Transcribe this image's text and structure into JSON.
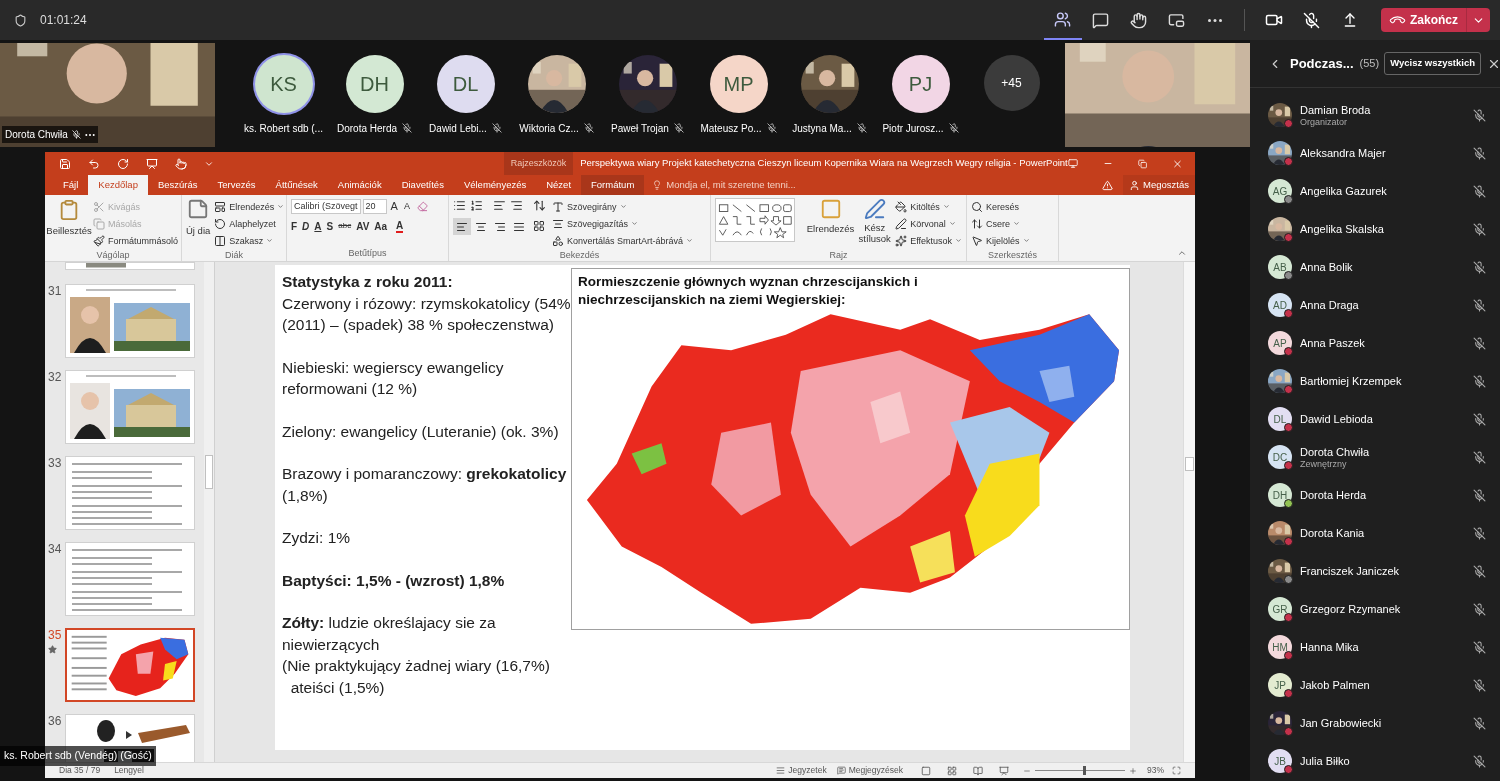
{
  "call_bar": {
    "timer": "01:01:24",
    "toolbar": [
      {
        "selected": true
      },
      {
        "selected": false
      },
      {
        "selected": false
      },
      {
        "selected": false
      },
      {
        "selected": false
      }
    ],
    "camera_on": true,
    "mic_muted": true,
    "end_button": "Zakończ"
  },
  "strip": {
    "left_video": {
      "name": "Dorota Chwiła",
      "muted": true
    },
    "avatars": [
      {
        "initials": "KS",
        "name": "ks. Robert sdb (...",
        "kind": "initials",
        "color": "#cfe5cf",
        "speaking": true,
        "muted": false
      },
      {
        "initials": "DH",
        "name": "Dorota Herda",
        "kind": "initials",
        "color": "#d3e8d3",
        "speaking": false,
        "muted": true
      },
      {
        "initials": "DL",
        "name": "Dawid Lebi...",
        "kind": "initials",
        "color": "#dedcf0",
        "speaking": false,
        "muted": true
      },
      {
        "name": "Wiktoria Cz...",
        "kind": "picture",
        "speaking": false,
        "muted": true
      },
      {
        "name": "Paweł Trojan",
        "kind": "picture",
        "speaking": false,
        "muted": true
      },
      {
        "initials": "MP",
        "name": "Mateusz Po...",
        "kind": "initials",
        "color": "#f5d6c8",
        "speaking": false,
        "muted": true
      },
      {
        "name": "Justyna Ma...",
        "kind": "picture",
        "speaking": false,
        "muted": true
      },
      {
        "initials": "PJ",
        "name": "Piotr Jurosz...",
        "kind": "initials",
        "color": "#f2d6e5",
        "speaking": false,
        "muted": true
      }
    ],
    "overflow": "+45"
  },
  "powerpoint": {
    "context_group": "Rajzeszközök",
    "title": "Perspektywa wiary Projekt katechetyczna Cieszyn liceum Kopernika Wiara na Wegrzech Wegry religia - PowerPoint",
    "tabs": [
      {
        "label": "Fájl",
        "selected": false,
        "kind": "normal"
      },
      {
        "label": "Kezdőlap",
        "selected": true,
        "kind": "normal"
      },
      {
        "label": "Beszúrás",
        "selected": false,
        "kind": "normal"
      },
      {
        "label": "Tervezés",
        "selected": false,
        "kind": "normal"
      },
      {
        "label": "Áttűnések",
        "selected": false,
        "kind": "normal"
      },
      {
        "label": "Animációk",
        "selected": false,
        "kind": "normal"
      },
      {
        "label": "Diavetítés",
        "selected": false,
        "kind": "normal"
      },
      {
        "label": "Véleményezés",
        "selected": false,
        "kind": "normal"
      },
      {
        "label": "Nézet",
        "selected": false,
        "kind": "normal"
      },
      {
        "label": "Formátum",
        "selected": false,
        "kind": "context"
      }
    ],
    "tell_me": {
      "placeholder": "Mondja el, mit szeretne tenni..."
    },
    "share": "Megosztás",
    "ribbon": {
      "clipboard": {
        "label": "Vágólap",
        "paste": "Beillesztés",
        "cut": {
          "label": "Kivágás",
          "disabled": true
        },
        "copy": {
          "label": "Másolás",
          "disabled": true
        },
        "format_painter": {
          "label": "Formátummásoló",
          "disabled": false
        }
      },
      "slides": {
        "label": "Diák",
        "new_slide": "Új dia",
        "layout": "Elrendezés",
        "reset": "Alaphelyzet",
        "section": "Szakasz"
      },
      "font": {
        "label": "Betűtípus",
        "font_name": "Calibri (Szövegt",
        "font_size": "20",
        "size_buttons": [
          "A",
          "A"
        ],
        "style_buttons": [
          "F",
          "D",
          "A",
          "S",
          "abc",
          "AV",
          "Aa"
        ],
        "color_button": "A"
      },
      "paragraph": {
        "label": "Bekezdés",
        "align_buttons": [
          {
            "selected": true
          },
          {
            "selected": false
          },
          {
            "selected": false
          },
          {
            "selected": false
          }
        ],
        "text_direction": "Szövegirány",
        "align_text": "Szövegigazítás",
        "smartart": "Konvertálás SmartArt-ábrává"
      },
      "drawing": {
        "label": "Rajz",
        "arrange": "Elrendezés",
        "quick_styles": "Kész stílusok",
        "fill": "Kitöltés",
        "outline": "Körvonal",
        "effects": "Effektusok"
      },
      "editing": {
        "label": "Szerkesztés",
        "find": "Keresés",
        "replace": "Csere",
        "select": "Kijelölés"
      }
    },
    "thumbnails": [
      {
        "kind": "partial",
        "selected": false,
        "animated": false
      },
      {
        "number": "31",
        "kind": "photos",
        "selected": false,
        "animated": false
      },
      {
        "number": "32",
        "kind": "photos",
        "selected": false,
        "animated": false
      },
      {
        "number": "33",
        "kind": "text",
        "selected": false,
        "animated": false
      },
      {
        "number": "34",
        "kind": "text",
        "selected": false,
        "animated": false
      },
      {
        "number": "35",
        "kind": "map",
        "selected": true,
        "animated": true
      },
      {
        "number": "36",
        "kind": "objects",
        "selected": false,
        "animated": false
      }
    ],
    "slide": {
      "blocks": [
        {
          "heading": "Statystyka z roku 2011:",
          "lines": [
            "Czerwony i rózowy: rzymskokatolicy (54% (2011) – (spadek) 38 % społeczenstwa)"
          ]
        },
        {
          "lines": [
            "Niebieski: wegierscy ewangelicy reformowani (12 %)"
          ]
        },
        {
          "lines": [
            "Zielony: ewangelicy (Luteranie) (ok. 3%)"
          ]
        },
        {
          "lines": [
            "Brazowy i pomaranczowy: **grekokatolicy** (1,8%)"
          ]
        },
        {
          "lines": [
            "Zydzi: 1%"
          ]
        },
        {
          "heading": "Baptyści: 1,5% - (wzrost) 1,8%"
        },
        {
          "lines": [
            "**Zółty:** ludzie określajacy sie za niewierzących",
            "(Nie praktykujący żadnej wiary (16,7%)",
            "  ateiści (1,5%)"
          ]
        }
      ],
      "map_title": "Rormieszczenie głównych wyznan chrzescijanskich i niechrzescijanskich na ziemi Wegierskiej:"
    },
    "status_bar": {
      "slide_count": "Dia 35 / 79",
      "language": "Lengyel",
      "notes": "Jegyzetek",
      "comments": "Megjegyzések",
      "zoom_slider": {
        "level": 0.55
      },
      "zoom": "93%"
    }
  },
  "presenter_tag": "ks. Robert sdb (Vendég) (Gość)",
  "panel": {
    "title": "Podczas...",
    "count": "(55)",
    "mute_all": "Wycisz wszystkich",
    "people": [
      {
        "name": "Damian Broda",
        "role": "Organizator",
        "kind": "picture",
        "offline": false,
        "available": false,
        "muted": true
      },
      {
        "name": "Aleksandra Majer",
        "kind": "picture",
        "offline": false,
        "available": false,
        "muted": true
      },
      {
        "name": "Angelika Gazurek",
        "initials": "AG",
        "kind": "initials",
        "color": "#d5e8d4",
        "offline": true,
        "available": false,
        "muted": true
      },
      {
        "name": "Angelika Skalska",
        "kind": "picture",
        "offline": false,
        "available": false,
        "muted": true
      },
      {
        "name": "Anna Bolik",
        "initials": "AB",
        "kind": "initials",
        "color": "#d5e8d4",
        "offline": true,
        "available": false,
        "muted": true
      },
      {
        "name": "Anna Draga",
        "initials": "AD",
        "kind": "initials",
        "color": "#d6e4f3",
        "offline": false,
        "available": false,
        "muted": true
      },
      {
        "name": "Anna Paszek",
        "initials": "AP",
        "kind": "initials",
        "color": "#f3d9dc",
        "offline": false,
        "available": false,
        "muted": true
      },
      {
        "name": "Bartłomiej Krzempek",
        "kind": "picture",
        "offline": false,
        "available": false,
        "muted": true
      },
      {
        "name": "Dawid Lebioda",
        "initials": "DL",
        "kind": "initials",
        "color": "#e2def2",
        "offline": false,
        "available": false,
        "muted": true
      },
      {
        "name": "Dorota Chwiła",
        "role": "Zewnętrzny",
        "initials": "DC",
        "kind": "initials",
        "color": "#d6e4f3",
        "offline": false,
        "available": false,
        "muted": true
      },
      {
        "name": "Dorota Herda",
        "initials": "DH",
        "kind": "initials",
        "color": "#d5e8d4",
        "offline": false,
        "available": true,
        "muted": true
      },
      {
        "name": "Dorota Kania",
        "kind": "picture",
        "offline": false,
        "available": false,
        "muted": true
      },
      {
        "name": "Franciszek Janiczek",
        "kind": "picture",
        "offline": true,
        "available": false,
        "muted": true
      },
      {
        "name": "Grzegorz Rzymanek",
        "initials": "GR",
        "kind": "initials",
        "color": "#d5e8d4",
        "offline": false,
        "available": false,
        "muted": true
      },
      {
        "name": "Hanna Mika",
        "initials": "HM",
        "kind": "initials",
        "color": "#f3d9dc",
        "offline": false,
        "available": false,
        "muted": true
      },
      {
        "name": "Jakob Palmen",
        "initials": "JP",
        "kind": "initials",
        "color": "#e3ebd0",
        "offline": false,
        "available": false,
        "muted": true
      },
      {
        "name": "Jan Grabowiecki",
        "kind": "picture",
        "offline": false,
        "available": false,
        "muted": true
      },
      {
        "name": "Julia Biłko",
        "initials": "JB",
        "kind": "initials",
        "color": "#e2def2",
        "offline": false,
        "available": false,
        "muted": true
      }
    ]
  }
}
